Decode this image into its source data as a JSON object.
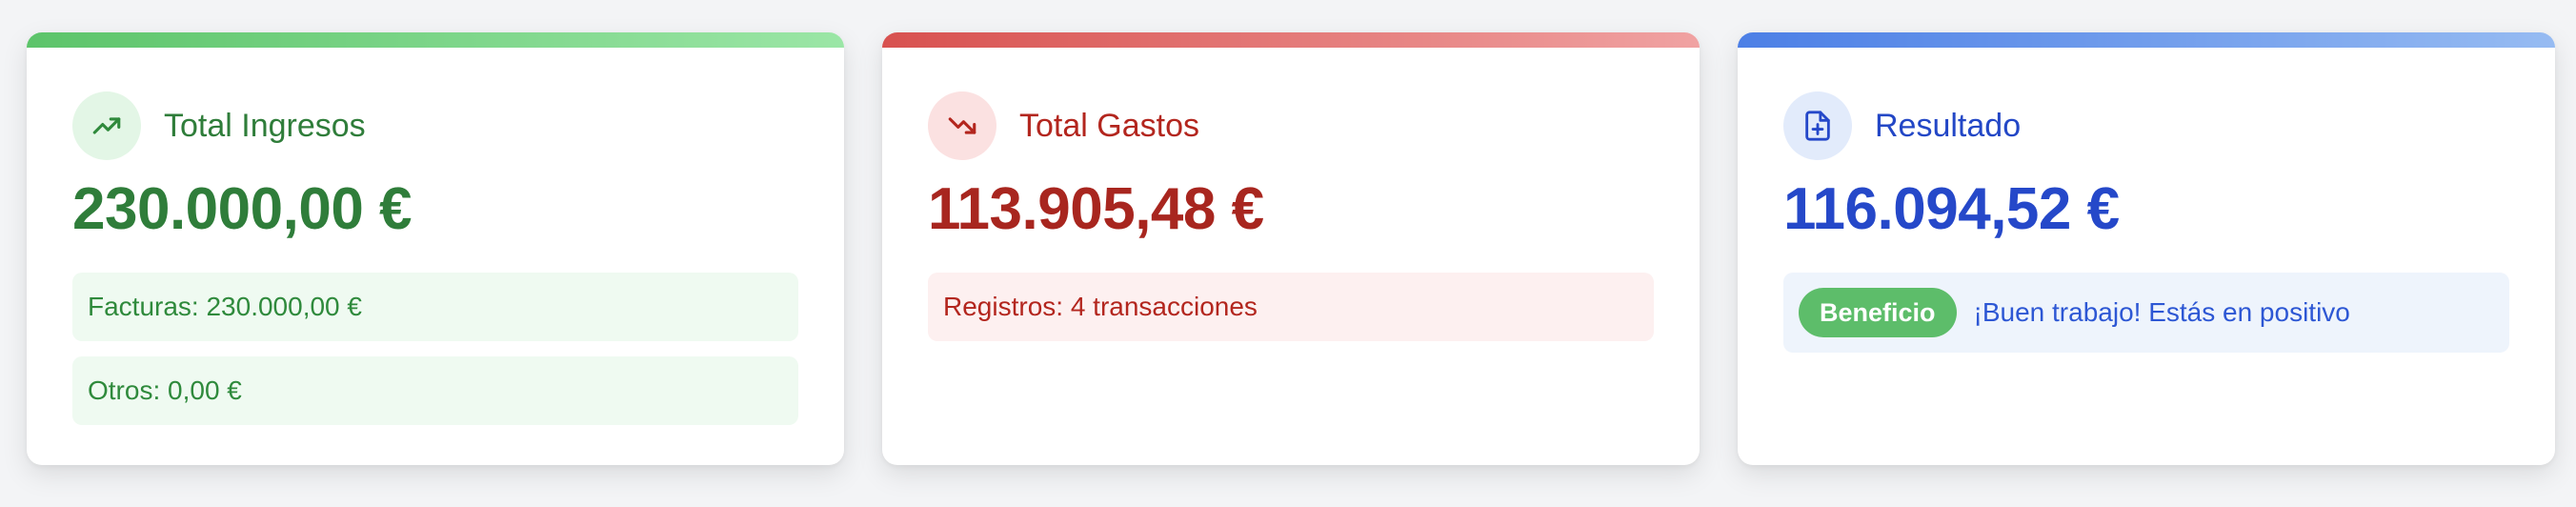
{
  "cards": [
    {
      "title": "Total Ingresos",
      "icon": "trending-up-icon",
      "amount": "230.000,00 €",
      "details": [
        "Facturas: 230.000,00 €",
        "Otros: 0,00 €"
      ]
    },
    {
      "title": "Total Gastos",
      "icon": "trending-down-icon",
      "amount": "113.905,48 €",
      "details": [
        "Registros: 4 transacciones"
      ]
    },
    {
      "title": "Resultado",
      "icon": "file-plus-icon",
      "amount": "116.094,52 €",
      "badge": "Beneficio",
      "message": "¡Buen trabajo! Estás en positivo"
    }
  ],
  "colors": {
    "income": "#2f7d3a",
    "expenses": "#a8261f",
    "result": "#2548c9",
    "badge": "#5dbd6a"
  }
}
